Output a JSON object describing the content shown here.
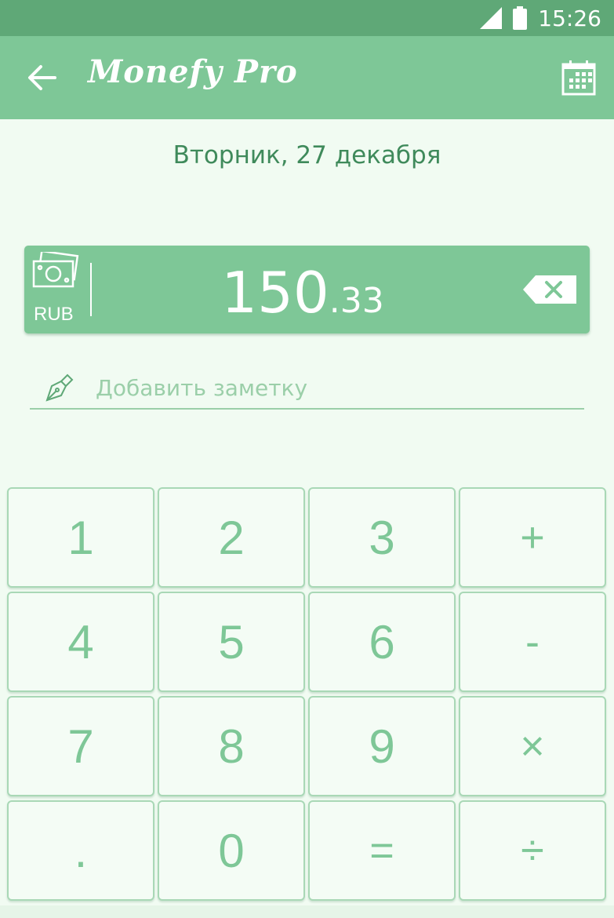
{
  "status_bar": {
    "time": "15:26",
    "icons": [
      "signal-icon",
      "battery-icon"
    ]
  },
  "app_bar": {
    "title": "Monefy Pro",
    "icons": [
      "back-arrow-icon",
      "calendar-icon"
    ]
  },
  "date_label": "Вторник, 27 декабря",
  "amount_panel": {
    "currency": "RUB",
    "amount_integer": "150",
    "amount_decimal": ".33",
    "icons": [
      "money-icon",
      "backspace-icon"
    ]
  },
  "note": {
    "placeholder": "Добавить заметку",
    "value": "",
    "icon": "pen-icon"
  },
  "keypad": {
    "rows": [
      [
        "1",
        "2",
        "3",
        "+"
      ],
      [
        "4",
        "5",
        "6",
        "-"
      ],
      [
        "7",
        "8",
        "9",
        "×"
      ],
      [
        ".",
        "0",
        "=",
        "÷"
      ]
    ]
  },
  "colors": {
    "status_bar": "#5fa877",
    "primary": "#7ec797",
    "background": "#f1fbf2",
    "text_dark": "#3f8a5b",
    "placeholder": "#9bcfa9"
  }
}
